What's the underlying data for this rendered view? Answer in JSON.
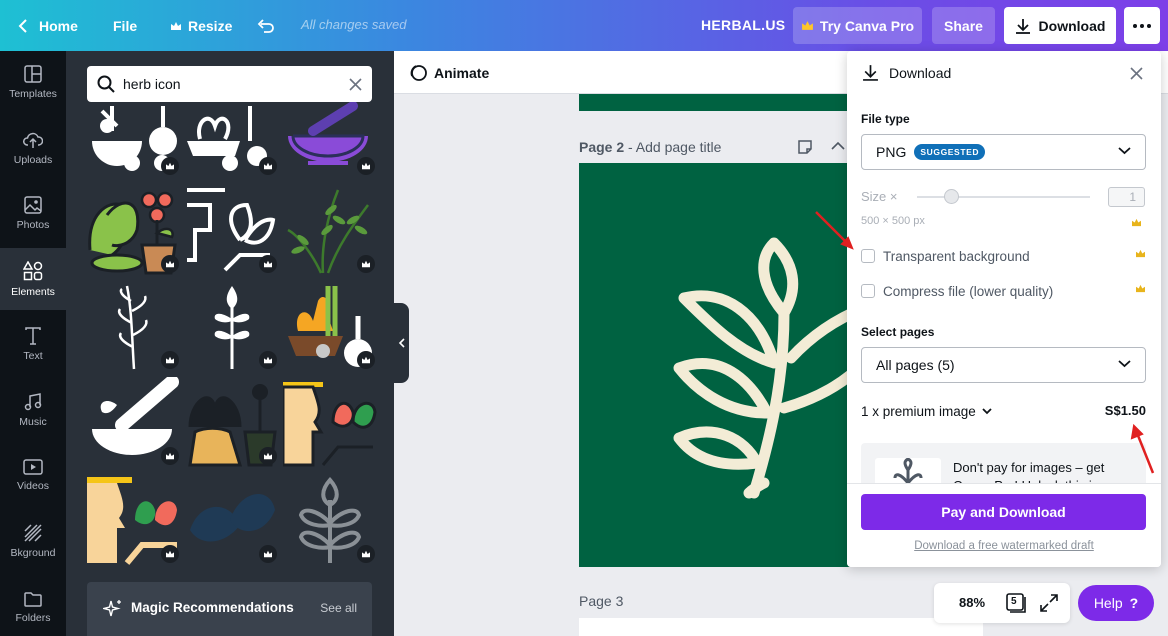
{
  "topbar": {
    "home_label": "Home",
    "file_label": "File",
    "resize_label": "Resize",
    "saved_status": "All changes saved",
    "design_name": "HERBAL.US",
    "try_pro_label": "Try Canva Pro",
    "share_label": "Share",
    "download_label": "Download"
  },
  "sidebar": {
    "items": [
      {
        "label": "Templates",
        "icon": "templates-icon"
      },
      {
        "label": "Uploads",
        "icon": "uploads-icon"
      },
      {
        "label": "Photos",
        "icon": "photos-icon"
      },
      {
        "label": "Elements",
        "icon": "elements-icon"
      },
      {
        "label": "Text",
        "icon": "text-icon"
      },
      {
        "label": "Music",
        "icon": "music-icon"
      },
      {
        "label": "Videos",
        "icon": "videos-icon"
      },
      {
        "label": "Bkground",
        "icon": "background-icon"
      },
      {
        "label": "Folders",
        "icon": "folders-icon"
      }
    ],
    "active": "Elements"
  },
  "elements_panel": {
    "search_value": "herb icon",
    "magic_title": "Magic Recommendations",
    "see_all": "See all"
  },
  "canvas": {
    "animate_label": "Animate",
    "page2_number": "Page 2",
    "page2_title_placeholder": "- Add page title",
    "page3_label": "Page 3",
    "page_bg": "#006241",
    "leaf_color": "#f3ecd6"
  },
  "download_panel": {
    "title": "Download",
    "file_type_label": "File type",
    "file_type_value": "PNG",
    "suggested_badge": "SUGGESTED",
    "size_label": "Size ×",
    "size_value": "1",
    "dimensions": "500 × 500 px",
    "transparent_bg_label": "Transparent background",
    "compress_label": "Compress file (lower quality)",
    "select_pages_label": "Select pages",
    "pages_value": "All pages (5)",
    "premium_label": "1 x premium image",
    "price": "S$1.50",
    "promo_text": "Don't pay for images – get Canva Pro! Unlock this image",
    "pay_button": "Pay and Download",
    "watermark_link": "Download a free watermarked draft"
  },
  "footer": {
    "zoom": "88%",
    "pages_count": "5",
    "help_label": "Help",
    "help_glyph": "?"
  },
  "colors": {
    "accent_purple": "#7d2ae8",
    "crown_gold": "#e8b41c",
    "annotation_red": "#e02020"
  }
}
